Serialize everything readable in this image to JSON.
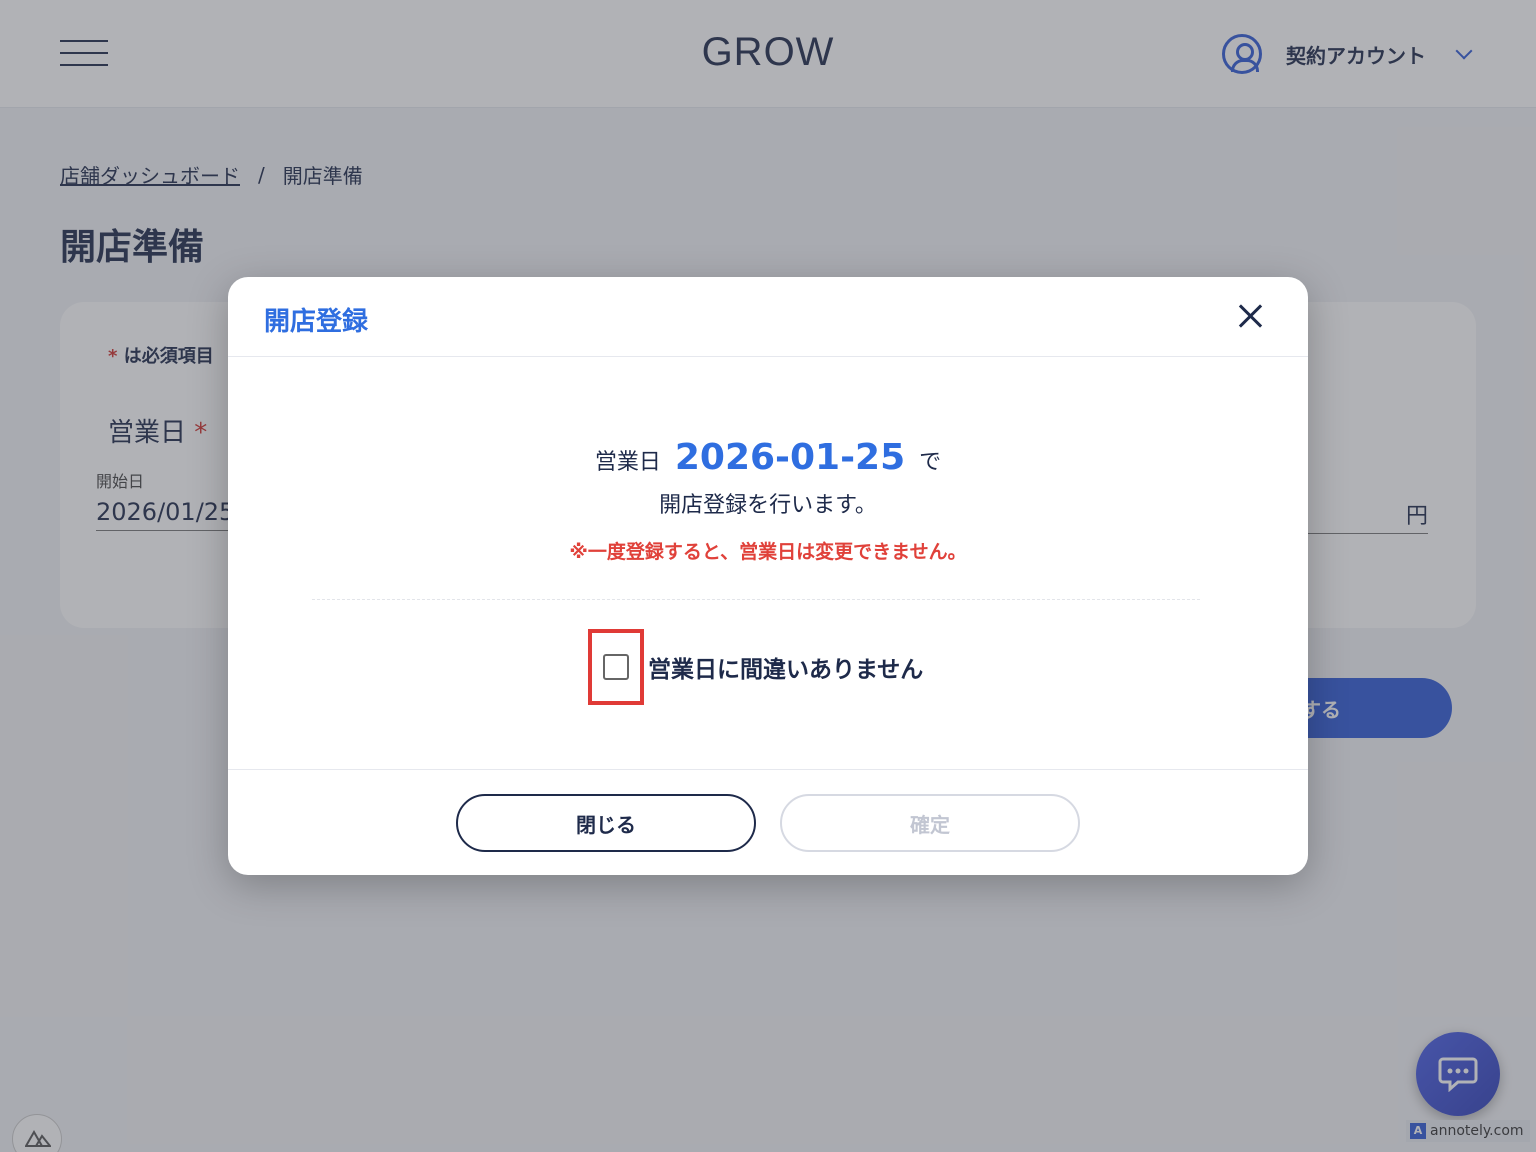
{
  "header": {
    "logo": "GROW",
    "account_label": "契約アカウント"
  },
  "breadcrumb": {
    "parent": "店舗ダッシュボード",
    "separator": "/",
    "current": "開店準備"
  },
  "page": {
    "title": "開店準備",
    "required_star": "*",
    "required_note": "は必須項目",
    "business_day_label": "営業日",
    "start_date_label": "開始日",
    "start_date_value": "2026/01/25",
    "yen_unit": "円",
    "submit_partial_label": "する"
  },
  "modal": {
    "title": "開店登録",
    "line1_prefix": "営業日",
    "date": "2026-01-25",
    "line1_suffix": "で",
    "line2": "開店登録を行います。",
    "warning": "※一度登録すると、営業日は変更できません。",
    "checkbox_label": "営業日に間違いありません",
    "checkbox_checked": false,
    "close_button": "閉じる",
    "confirm_button": "確定",
    "confirm_disabled": true
  },
  "watermark": {
    "icon_letter": "A",
    "text": "annotely.com"
  },
  "colors": {
    "accent": "#2f6ee0",
    "brand_dark": "#1e2a4a",
    "warning": "#e0413a",
    "highlight_border": "#e03a36"
  },
  "icons": [
    "menu-icon",
    "user-circle-icon",
    "chevron-down-icon",
    "close-icon",
    "chat-icon",
    "nuxt-logo-icon"
  ]
}
